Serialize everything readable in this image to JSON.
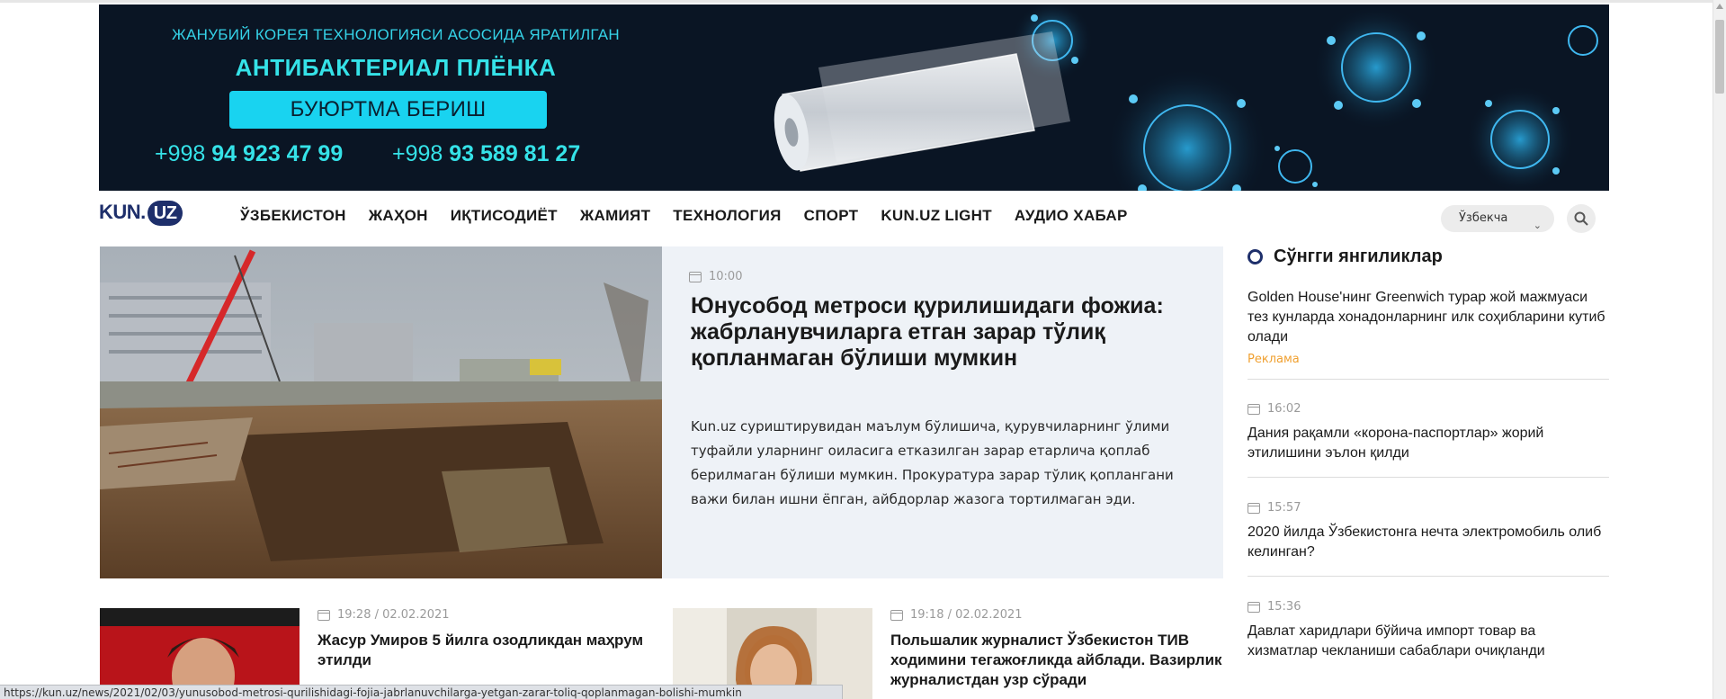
{
  "banner": {
    "line1": "ЖАНУБИЙ КОРЕЯ ТЕХНОЛОГИЯСИ АСОСИДА ЯРАТИЛГАН",
    "line2": "АНТИБАКТЕРИАЛ ПЛЁНКА",
    "button": "БУЮРТМА БЕРИШ",
    "phone1_prefix": "+998",
    "phone1_number": "94 923 47 99",
    "phone2_prefix": "+998",
    "phone2_number": "93 589 81 27"
  },
  "header": {
    "logo_text": "KUN.",
    "logo_badge": "UZ",
    "nav": [
      "ЎЗБЕКИСТОН",
      "ЖАҲОН",
      "ИҚТИСОДИЁТ",
      "ЖАМИЯТ",
      "ТЕХНОЛОГИЯ",
      "СПОРТ",
      "KUN.UZ LIGHT",
      "АУДИО ХАБАР"
    ],
    "language": "Ўзбекча",
    "icons": {
      "search": "search-icon",
      "chevron": "chevron-down-icon"
    }
  },
  "hero": {
    "time": "10:00",
    "title": "Юнусобод метроси қурилишидаги фожиа: жабрланувчиларга етган зарар тўлиқ қопланмаган бўлиши мумкин",
    "summary": "Kun.uz суриштирувидан маълум бўлишича, қурувчиларнинг ўлими туфайли уларнинг оиласига етказилган зарар етарлича қоплаб берилмаган бўлиши мумкин. Прокуратура зарар тўлиқ қоплангани важи билан ишни ёпган, айбдорлар жазога тортилмаган эди."
  },
  "cards": [
    {
      "time": "19:28 / 02.02.2021",
      "title": "Жасур Умиров 5 йилга озодликдан маҳрум этилди"
    },
    {
      "time": "19:18 / 02.02.2021",
      "title": "Польшалик журналист Ўзбекистон ТИВ ходимини тегажоғликда айблади. Вазирлик журналистдан узр сўради"
    }
  ],
  "sidebar": {
    "title": "Сўнгги янгиликлар",
    "items": [
      {
        "time": "",
        "title": "Golden House'нинг Greenwich турар жой мажмуаси тез кунларда хонадонларнинг илк соҳибларини кутиб олади",
        "tag": "Реклама"
      },
      {
        "time": "16:02",
        "title": "Дания рақамли «корона-паспортлар» жорий этилишини эълон қилди",
        "tag": ""
      },
      {
        "time": "15:57",
        "title": "2020 йилда Ўзбекистонга нечта электромобиль олиб келинган?",
        "tag": ""
      },
      {
        "time": "15:36",
        "title": "Давлат харидлари бўйича импорт товар ва хизматлар чекланиши сабаблари очиқланди",
        "tag": ""
      }
    ]
  },
  "status_url": "https://kun.uz/news/2021/02/03/yunusobod-metrosi-qurilishidagi-fojia-jabrlanuvchilarga-yetgan-zarar-toliq-qoplanmagan-bolishi-mumkin",
  "colors": {
    "brand": "#1e2f6b",
    "accent_cyan": "#19d3f0",
    "ad_tag": "#f0a030",
    "hero_panel": "#eef2f7"
  }
}
